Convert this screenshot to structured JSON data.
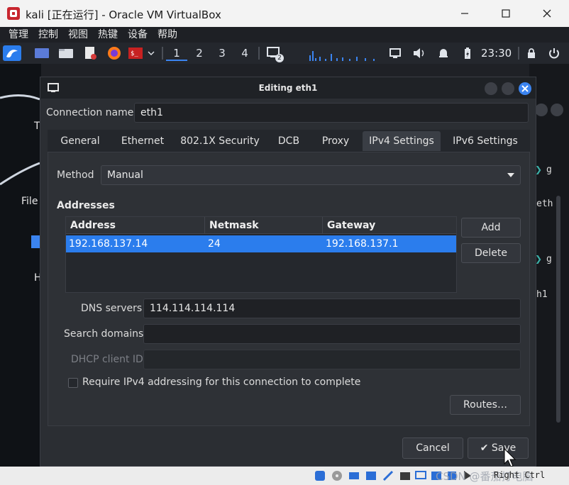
{
  "host": {
    "title": "kali [正在运行] - Oracle VM VirtualBox",
    "menu": [
      "管理",
      "控制",
      "视图",
      "热键",
      "设备",
      "帮助"
    ]
  },
  "panel": {
    "workspaces": [
      "1",
      "2",
      "3",
      "4"
    ],
    "clock": "23:30",
    "notification_badge": "2"
  },
  "desktop": {
    "left_fragments": [
      "T",
      "File",
      "H"
    ],
    "right_fragments": [
      "g",
      "eth",
      "g",
      "h1"
    ]
  },
  "dialog": {
    "title": "Editing eth1",
    "connection_name_label": "Connection name",
    "connection_name": "eth1",
    "tabs": [
      "General",
      "Ethernet",
      "802.1X Security",
      "DCB",
      "Proxy",
      "IPv4 Settings",
      "IPv6 Settings"
    ],
    "selected_tab": "IPv4 Settings",
    "method_label": "Method",
    "method": "Manual",
    "addresses_heading": "Addresses",
    "columns": [
      "Address",
      "Netmask",
      "Gateway"
    ],
    "rows": [
      {
        "address": "192.168.137.14",
        "netmask": "24",
        "gateway": "192.168.137.1"
      }
    ],
    "add_label": "Add",
    "delete_label": "Delete",
    "dns_label": "DNS servers",
    "dns_value": "114.114.114.114",
    "search_label": "Search domains",
    "search_value": "",
    "dhcp_label": "DHCP client ID",
    "dhcp_value": "",
    "require_label": "Require IPv4 addressing for this connection to complete",
    "require_checked": false,
    "routes_label": "Routes…",
    "cancel_label": "Cancel",
    "save_label": "Save"
  },
  "statusbar": {
    "host_key": "Right Ctrl",
    "watermark": "CSDN @番茄打电脑"
  },
  "colors": {
    "accent": "#2b7ded",
    "dialog_bg": "#2b2e33",
    "panel_bg": "#24272d"
  }
}
